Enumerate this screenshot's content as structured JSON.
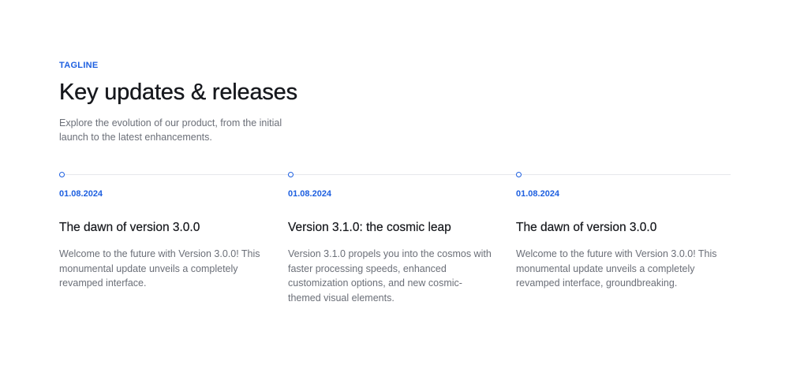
{
  "header": {
    "tagline": "TAGLINE",
    "title": "Key updates & releases",
    "subtitle": "Explore the evolution of our product, from the initial launch to the latest enhancements."
  },
  "timeline": {
    "items": [
      {
        "date": "01.08.2024",
        "title": "The dawn of version 3.0.0",
        "body": "Welcome to the future with Version 3.0.0! This monumental update unveils a completely revamped interface."
      },
      {
        "date": "01.08.2024",
        "title": "Version 3.1.0: the cosmic leap",
        "body": "Version 3.1.0 propels you into the cosmos with faster processing speeds, enhanced customization options, and new cosmic-themed visual elements."
      },
      {
        "date": "01.08.2024",
        "title": "The dawn of version 3.0.0",
        "body": "Welcome to the future with Version 3.0.0! This monumental update unveils a completely revamped interface, groundbreaking."
      }
    ]
  },
  "colors": {
    "accent": "#1d5fe0",
    "heading": "#16181d",
    "body_text": "#6b6f78",
    "divider": "#e6e8ec",
    "background": "#ffffff"
  },
  "icons": {
    "timeline_marker": "timeline-dot-icon"
  }
}
